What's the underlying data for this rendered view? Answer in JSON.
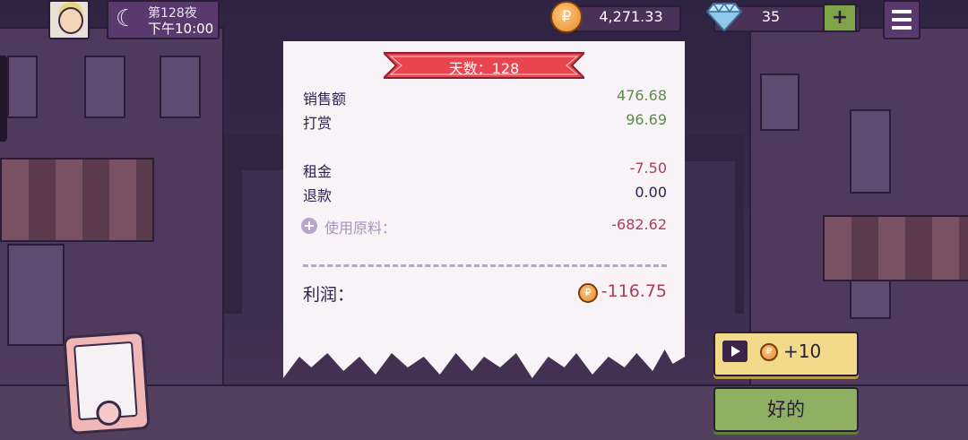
{
  "hud": {
    "night": "第128夜",
    "clock": "下午10:00",
    "coins": "4,271.33",
    "gems": "35",
    "gem_plus": "+"
  },
  "receipt": {
    "day_banner": "天数：128",
    "sales_label": "销售额",
    "sales_value": "476.68",
    "tips_label": "打赏",
    "tips_value": "96.69",
    "rent_label": "租金",
    "rent_value": "-7.50",
    "refund_label": "退款",
    "refund_value": "0.00",
    "ingredients_label": "使用原料：",
    "ingredients_value": "-682.62",
    "profit_label": "利润：",
    "profit_value": "-116.75"
  },
  "buttons": {
    "ad_reward": "+10",
    "ok": "好的"
  },
  "colors": {
    "positive": "#5f8a4e",
    "negative": "#b23b57",
    "ok_button": "#8fb063",
    "ad_button": "#f3d98a",
    "banner": "#e9454f"
  }
}
